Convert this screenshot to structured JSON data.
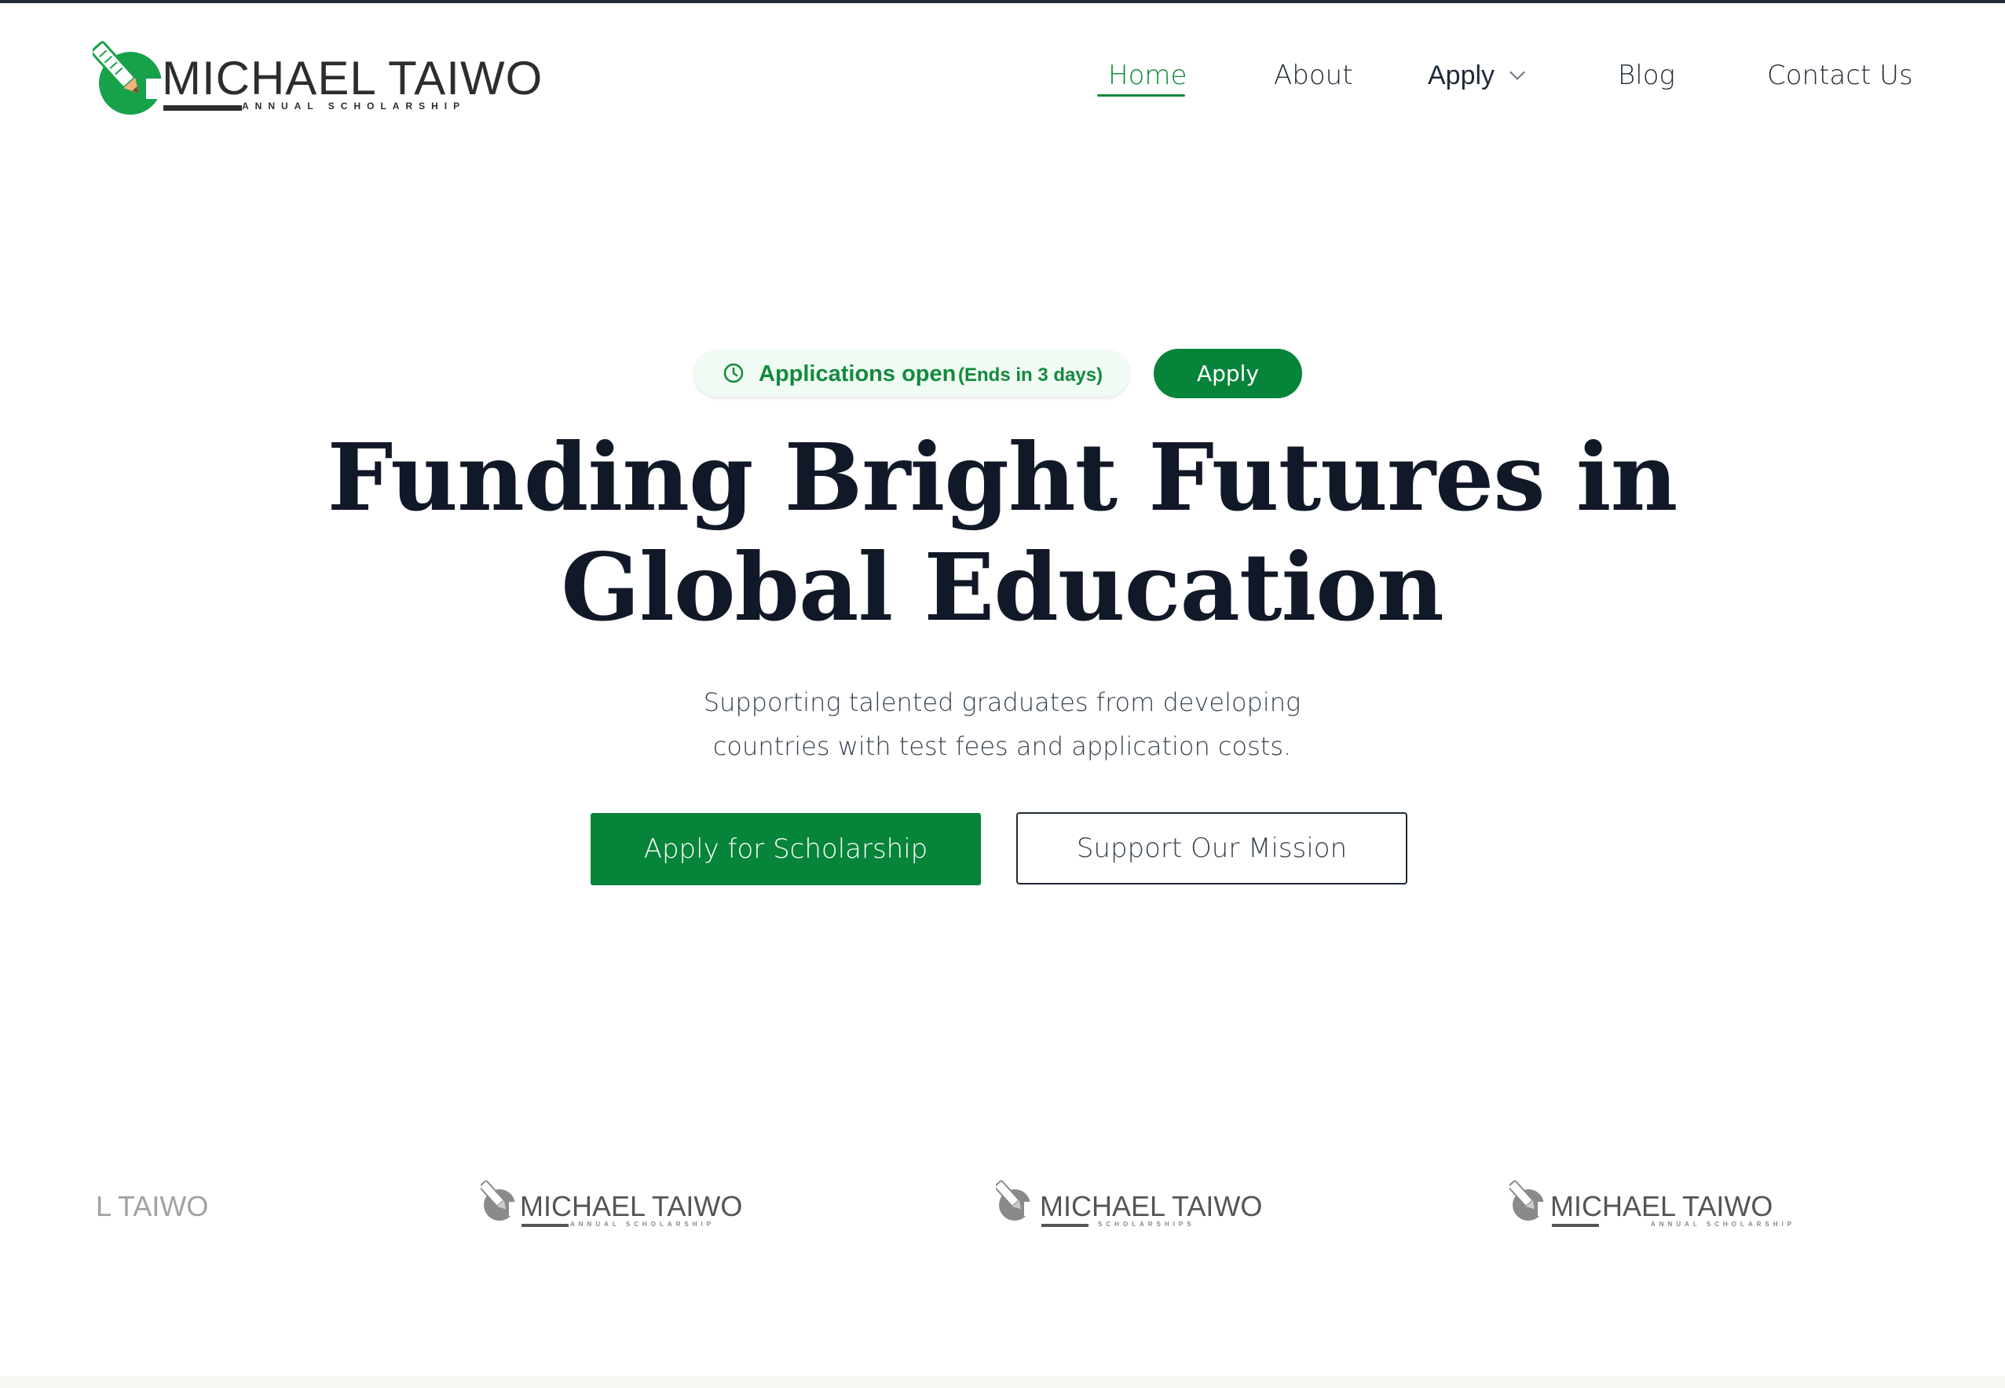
{
  "brand": {
    "name": "MICHAEL TAIWO",
    "tagline": "ANNUAL SCHOLARSHIP",
    "green": "#0b8a3a",
    "dark": "#111827"
  },
  "nav": {
    "home": "Home",
    "about": "About",
    "apply": "Apply",
    "blog": "Blog",
    "contact": "Contact Us",
    "active": "Home"
  },
  "hero": {
    "status_label": "Applications open",
    "status_note": "(Ends in 3 days)",
    "status_button": "Apply",
    "headline_line1": "Funding Bright Futures in",
    "headline_line2": "Global Education",
    "subtext_line1": "Supporting talented graduates from developing",
    "subtext_line2": "countries with test fees and application costs.",
    "primary_cta": "Apply for Scholarship",
    "secondary_cta": "Support Our Mission"
  },
  "logo_strip": [
    {
      "name_partial": "L TAIWO"
    },
    {
      "name": "MICHAEL TAIWO",
      "sub": "ANNUAL SCHOLARSHIP"
    },
    {
      "name": "MICHAEL TAIWO",
      "sub": "SCHOLARSHIPS"
    },
    {
      "name": "MICHAEL TAIWO",
      "sub": "ANNUAL SCHOLARSHIP"
    }
  ],
  "icons": {
    "clock": "clock-icon",
    "chevron": "chevron-down-icon",
    "logo": "pencil-logo-icon"
  }
}
